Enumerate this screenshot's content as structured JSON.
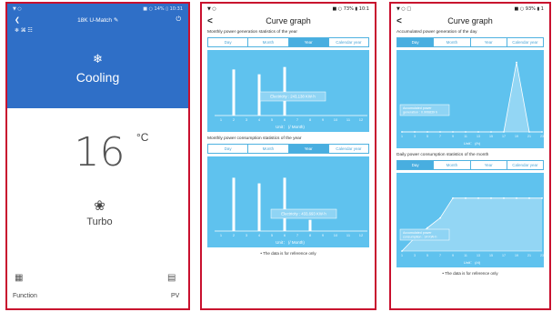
{
  "phone1": {
    "title": "18K U-Match",
    "edit_icon": "pencil-icon",
    "back_icon": "chevron-left-icon",
    "power_icon": "power-icon",
    "mini_status": "❄ ⌘ ☷",
    "mode_icon": "❄",
    "mode_label": "Cooling",
    "temperature": "16",
    "temp_unit": "°C",
    "fan_icon": "❀",
    "fan_label": "Turbo",
    "function_icon": "▦",
    "function_label": "Function",
    "pv_icon": "▤",
    "pv_label": "PV",
    "status_left": "▼ ○",
    "status_right": "■ ○ 14% ▯ 10:31"
  },
  "phone2": {
    "status_left": "▼ ○",
    "status_right": "■ ○ 73% ▮ 10:1",
    "back": "<",
    "title": "Curve graph",
    "section1": "Monthly power generation statistics of the year",
    "tabs": [
      "Day",
      "Month",
      "Year",
      "Calendar year"
    ],
    "active_tab": 2,
    "chart1_label": "Electricity : 243,138 KW·h",
    "chart1_unit": "Unit： (/ Month)",
    "section2": "Monthly power consumption statistics of the year",
    "chart2_label": "Electricity : 433,693 KW·h",
    "chart2_unit": "Unit： (/ Month)",
    "note": "• The data is for reference only"
  },
  "phone3": {
    "status_left": "▼ ○ □",
    "status_right": "■ ○ 93% ▮ 1",
    "back": "<",
    "title": "Curve graph",
    "section1": "Accumulated power generation of the day",
    "tabs": [
      "Day",
      "Month",
      "Year",
      "Calendar year"
    ],
    "active_tab": 0,
    "chart1_label_l1": "Accumulated power",
    "chart1_label_l2": "generation : 0.906839 h",
    "chart1_unit": "Unit： (/h)",
    "section2": "Daily power consumption statistics of the month",
    "chart2_label_l1": "Accumulated power",
    "chart2_label_l2": "consumption : 14 KW·h",
    "chart2_unit": "Unit： (/d)",
    "note": "• The data is for reference only"
  },
  "chart_data": [
    {
      "type": "bar",
      "categories": [
        "1",
        "2",
        "3",
        "4",
        "5",
        "6",
        "7",
        "8",
        "9",
        "10",
        "11",
        "12"
      ],
      "values": [
        0,
        95,
        0,
        85,
        0,
        100,
        0,
        0,
        0,
        0,
        0,
        0
      ],
      "ylim": [
        0,
        120
      ]
    },
    {
      "type": "bar",
      "categories": [
        "1",
        "2",
        "3",
        "4",
        "5",
        "6",
        "7",
        "8",
        "9",
        "10",
        "11",
        "12"
      ],
      "values": [
        0,
        95,
        0,
        85,
        0,
        95,
        0,
        20,
        0,
        0,
        0,
        0
      ],
      "ylim": [
        0,
        120
      ]
    },
    {
      "type": "area",
      "x": [
        "1",
        "3",
        "5",
        "7",
        "9",
        "11",
        "13",
        "15",
        "17",
        "19",
        "21",
        "23"
      ],
      "values": [
        0,
        0,
        0,
        0,
        0,
        0,
        0,
        0,
        0,
        100,
        0,
        0
      ],
      "ylim": [
        0,
        110
      ]
    },
    {
      "type": "area",
      "x": [
        "1",
        "3",
        "5",
        "7",
        "9",
        "11",
        "13",
        "15",
        "17",
        "19",
        "21",
        "23"
      ],
      "values": [
        0,
        20,
        35,
        50,
        80,
        80,
        80,
        80,
        80,
        80,
        80,
        80
      ],
      "ylim": [
        0,
        110
      ]
    }
  ],
  "colors": {
    "header_blue": "#2f6fc7",
    "chart_bg": "#5fc2ee",
    "accent": "#48aee0",
    "frame": "#c8102e"
  }
}
